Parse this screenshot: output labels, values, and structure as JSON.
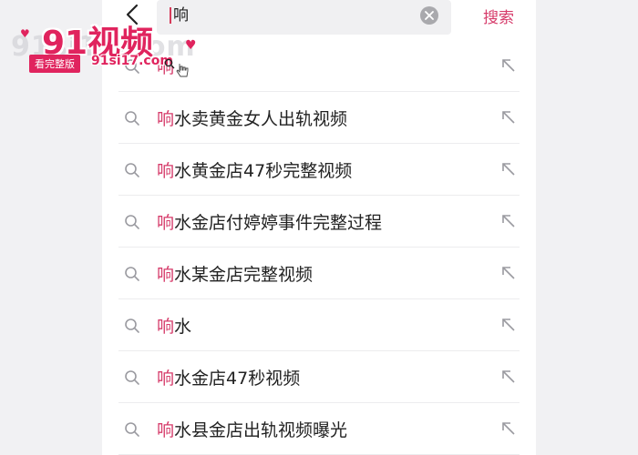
{
  "header": {
    "query": "响",
    "submit_label": "搜索"
  },
  "suggestions": [
    {
      "highlight": "响",
      "rest": ""
    },
    {
      "highlight": "响",
      "rest": "水卖黄金女人出轨视频"
    },
    {
      "highlight": "响",
      "rest": "水黄金店47秒完整视频"
    },
    {
      "highlight": "响",
      "rest": "水金店付婷婷事件完整过程"
    },
    {
      "highlight": "响",
      "rest": "水某金店完整视频"
    },
    {
      "highlight": "响",
      "rest": "水"
    },
    {
      "highlight": "响",
      "rest": "水金店47秒视频"
    },
    {
      "highlight": "响",
      "rest": "水县金店出轨视频曝光"
    }
  ],
  "watermark": {
    "title": "91视频",
    "tag": "看完整版",
    "url": "91si17.com",
    "bg_text": "91si17.com"
  },
  "colors": {
    "accent": "#d63b6a",
    "brand": "#e0245e"
  },
  "icons": {
    "back": "chevron-left-icon",
    "clear": "clear-icon",
    "search": "search-icon",
    "fill": "arrow-up-left-icon"
  }
}
